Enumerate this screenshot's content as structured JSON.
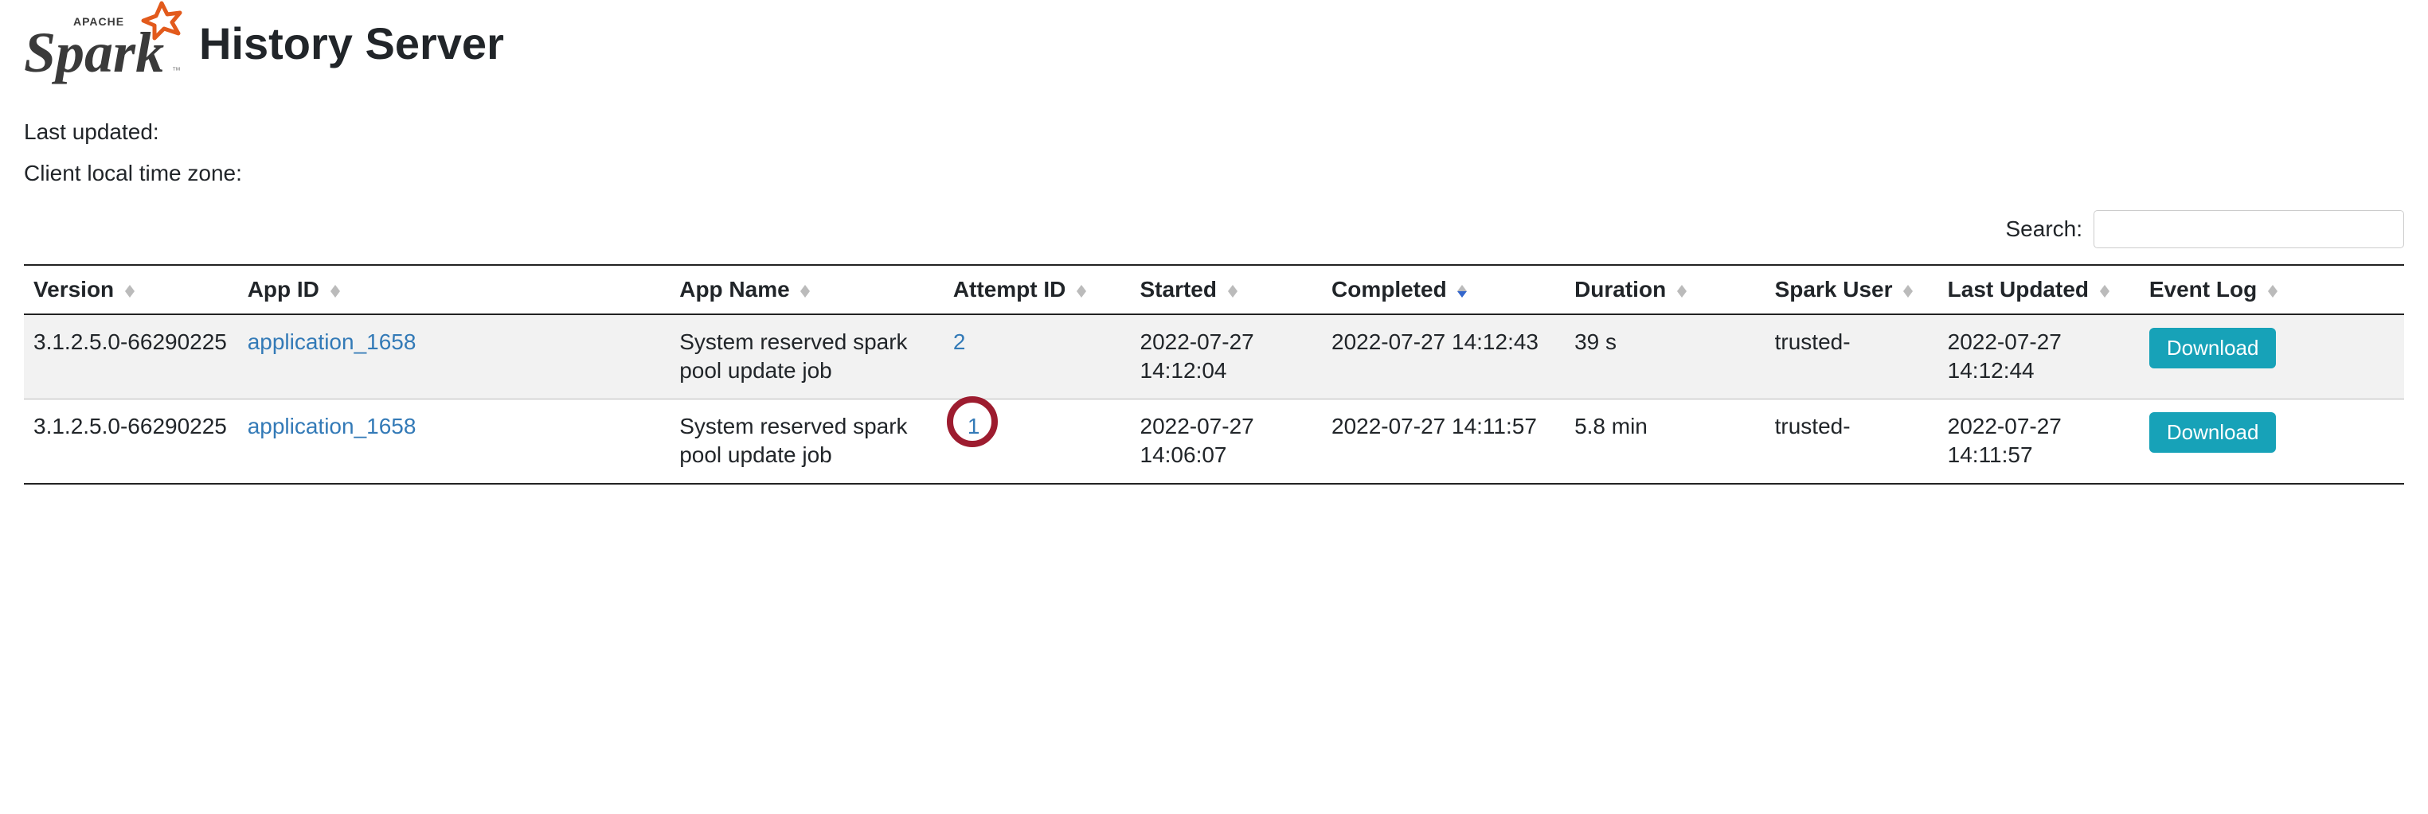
{
  "header": {
    "title": "History Server",
    "logo_apache": "APACHE",
    "logo_spark": "Spark"
  },
  "meta": {
    "last_updated_label": "Last updated:",
    "client_tz_label": "Client local time zone:"
  },
  "search": {
    "label": "Search:",
    "value": ""
  },
  "table": {
    "columns": {
      "version": "Version",
      "app_id": "App ID",
      "app_name": "App Name",
      "attempt_id": "Attempt ID",
      "started": "Started",
      "completed": "Completed",
      "duration": "Duration",
      "spark_user": "Spark User",
      "last_updated": "Last Updated",
      "event_log": "Event Log"
    },
    "sort_column": "completed",
    "sort_dir": "desc",
    "download_label": "Download",
    "rows": [
      {
        "version": "3.1.2.5.0-66290225",
        "app_id": "application_1658",
        "app_name": "System reserved spark pool update job",
        "attempt_id": "2",
        "started": "2022-07-27 14:12:04",
        "completed": "2022-07-27 14:12:43",
        "duration": "39 s",
        "spark_user": "trusted-",
        "last_updated": "2022-07-27 14:12:44",
        "highlighted": false
      },
      {
        "version": "3.1.2.5.0-66290225",
        "app_id": "application_1658",
        "app_name": "System reserved spark pool update job",
        "attempt_id": "1",
        "started": "2022-07-27 14:06:07",
        "completed": "2022-07-27 14:11:57",
        "duration": "5.8 min",
        "spark_user": "trusted-",
        "last_updated": "2022-07-27 14:11:57",
        "highlighted": true
      }
    ]
  }
}
